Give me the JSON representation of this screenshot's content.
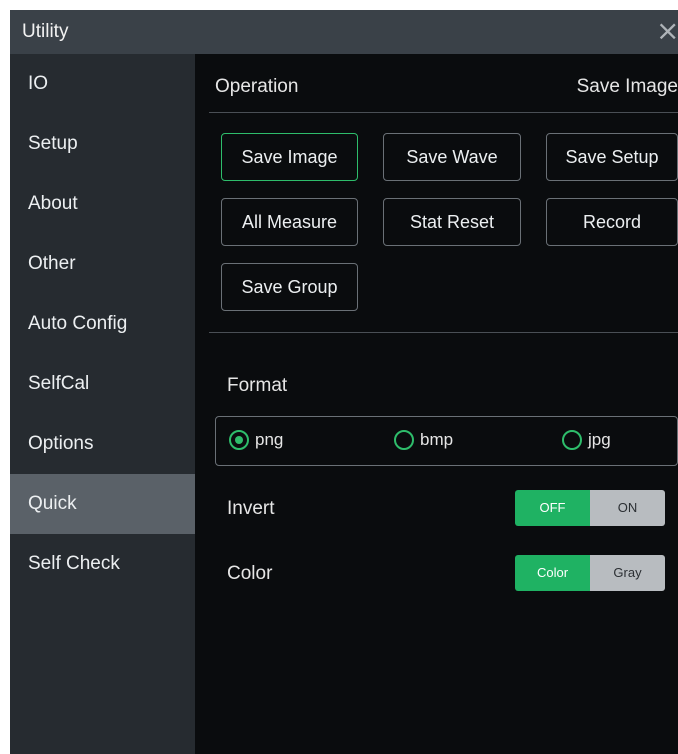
{
  "window": {
    "title": "Utility",
    "close_glyph": "×",
    "close_icon": "close-icon"
  },
  "sidebar": {
    "items": [
      {
        "label": "IO"
      },
      {
        "label": "Setup"
      },
      {
        "label": "About"
      },
      {
        "label": "Other"
      },
      {
        "label": "Auto Config"
      },
      {
        "label": "SelfCal"
      },
      {
        "label": "Options"
      },
      {
        "label": "Quick",
        "active": true
      },
      {
        "label": "Self Check"
      }
    ]
  },
  "operation": {
    "label": "Operation",
    "value": "Save Image",
    "buttons": [
      {
        "label": "Save Image",
        "selected": true
      },
      {
        "label": "Save Wave"
      },
      {
        "label": "Save Setup"
      },
      {
        "label": "All Measure"
      },
      {
        "label": "Stat Reset"
      },
      {
        "label": "Record"
      },
      {
        "label": "Save Group"
      }
    ]
  },
  "format": {
    "label": "Format",
    "options": [
      {
        "label": "png",
        "selected": true
      },
      {
        "label": "bmp",
        "selected": false
      },
      {
        "label": "jpg",
        "selected": false
      }
    ]
  },
  "invert": {
    "label": "Invert",
    "off_label": "OFF",
    "on_label": "ON",
    "value": "OFF"
  },
  "color": {
    "label": "Color",
    "color_label": "Color",
    "gray_label": "Gray",
    "value": "Color"
  },
  "colors": {
    "accent": "#1fb263",
    "panel": "#0a0c0e",
    "sidebar": "#262b30",
    "sidebar_active": "#5a6168",
    "titlebar": "#3a4148"
  }
}
